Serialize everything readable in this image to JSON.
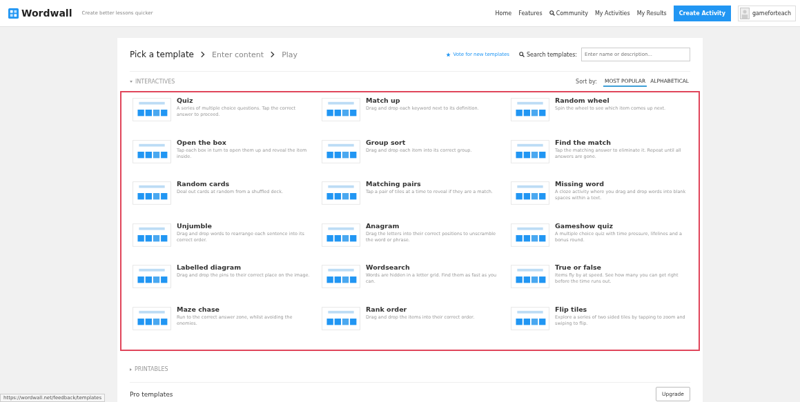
{
  "header": {
    "logo": "Wordwall",
    "tagline": "Create better lessons quicker",
    "nav": [
      {
        "label": "Home",
        "kind": "link"
      },
      {
        "label": "Features",
        "kind": "link"
      },
      {
        "label": "Community",
        "kind": "search-link"
      },
      {
        "label": "My Activities",
        "kind": "link"
      },
      {
        "label": "My Results",
        "kind": "link"
      }
    ],
    "create_button": "Create Activity",
    "user": "gameforteach"
  },
  "steps": [
    {
      "label": "Pick a template",
      "selected": true
    },
    {
      "label": "Enter content",
      "selected": false
    },
    {
      "label": "Play",
      "selected": false
    }
  ],
  "vote_link": "Vote for new templates",
  "search": {
    "label": "Search templates:",
    "placeholder": "Enter name or description..."
  },
  "sections": [
    {
      "title": "INTERACTIVES",
      "expanded": true
    },
    {
      "title": "PRINTABLES",
      "expanded": false
    }
  ],
  "sort": {
    "label": "Sort by:",
    "options": [
      {
        "label": "MOST POPULAR",
        "selected": true
      },
      {
        "label": "ALPHABETICAL",
        "selected": false
      }
    ]
  },
  "templates": [
    {
      "name": "Quiz",
      "description": "A series of multiple choice questions. Tap the correct answer to proceed."
    },
    {
      "name": "Match up",
      "description": "Drag and drop each keyword next to its definition."
    },
    {
      "name": "Random wheel",
      "description": "Spin the wheel to see which item comes up next."
    },
    {
      "name": "Open the box",
      "description": "Tap each box in turn to open them up and reveal the item inside."
    },
    {
      "name": "Group sort",
      "description": "Drag and drop each item into its correct group."
    },
    {
      "name": "Find the match",
      "description": "Tap the matching answer to eliminate it. Repeat until all answers are gone."
    },
    {
      "name": "Random cards",
      "description": "Deal out cards at random from a shuffled deck."
    },
    {
      "name": "Matching pairs",
      "description": "Tap a pair of tiles at a time to reveal if they are a match."
    },
    {
      "name": "Missing word",
      "description": "A cloze activity where you drag and drop words into blank spaces within a text."
    },
    {
      "name": "Unjumble",
      "description": "Drag and drop words to rearrange each sentence into its correct order."
    },
    {
      "name": "Anagram",
      "description": "Drag the letters into their correct positions to unscramble the word or phrase."
    },
    {
      "name": "Gameshow quiz",
      "description": "A multiple choice quiz with time pressure, lifelines and a bonus round."
    },
    {
      "name": "Labelled diagram",
      "description": "Drag and drop the pins to their correct place on the image."
    },
    {
      "name": "Wordsearch",
      "description": "Words are hidden in a letter grid. Find them as fast as you can."
    },
    {
      "name": "True or false",
      "description": "Items fly by at speed. See how many you can get right before the time runs out."
    },
    {
      "name": "Maze chase",
      "description": "Run to the correct answer zone, whilst avoiding the enemies."
    },
    {
      "name": "Rank order",
      "description": "Drag and drop the items into their correct order."
    },
    {
      "name": "Flip tiles",
      "description": "Explore a series of two sided tiles by tapping to zoom and swiping to flip."
    }
  ],
  "pro": {
    "title": "Pro templates",
    "button": "Upgrade"
  },
  "status_url": "https://wordwall.net/feedback/templates"
}
